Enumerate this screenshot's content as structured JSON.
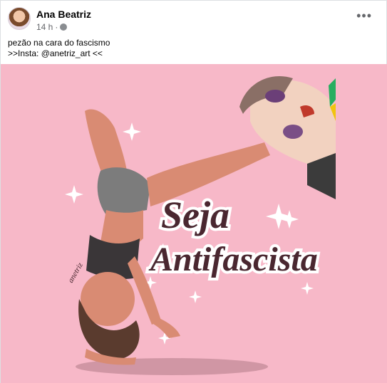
{
  "post": {
    "author": "Ana Beatriz",
    "time": "14 h",
    "privacy_icon": "globe-icon",
    "more_icon": "more-options-icon",
    "caption_line1": "pezão na cara do fascismo",
    "caption_line2": ">>Insta: @anetriz_art <<"
  },
  "artwork": {
    "text_line1": "Seja",
    "text_line2": "Antifascista",
    "signature": "anetriz",
    "background_color": "#f7b8c8",
    "text_color": "#4a2730"
  }
}
